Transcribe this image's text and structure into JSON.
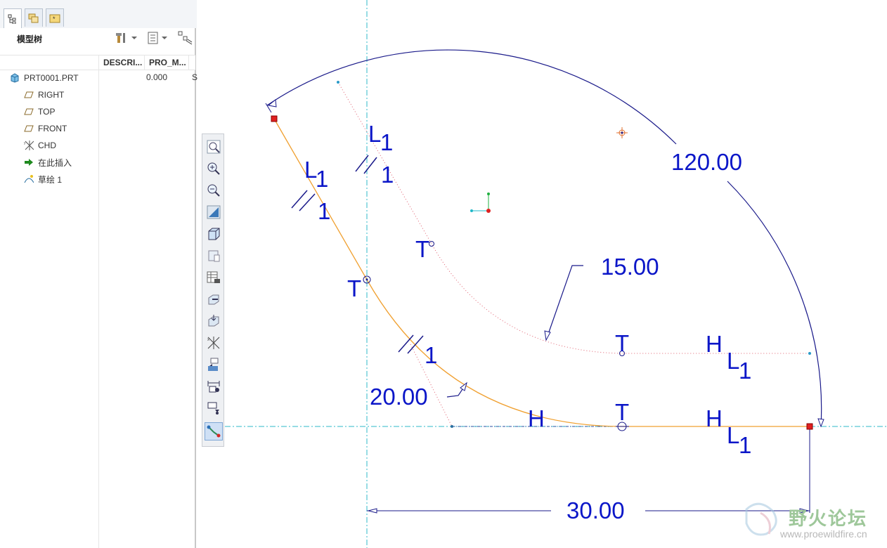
{
  "panel": {
    "title": "模型树",
    "columns": [
      "DESCRI...",
      "PRO_M..."
    ],
    "col_extra": "S",
    "tabs": [
      "model-tree-tab",
      "layers-tab",
      "favorites-tab"
    ]
  },
  "tree": {
    "items": [
      {
        "label": "PRT0001.PRT",
        "value": "0.000",
        "icon": "part-icon"
      },
      {
        "label": "RIGHT",
        "icon": "datum-plane-icon"
      },
      {
        "label": "TOP",
        "icon": "datum-plane-icon"
      },
      {
        "label": "FRONT",
        "icon": "datum-plane-icon"
      },
      {
        "label": "CHD",
        "icon": "coordinate-system-icon"
      },
      {
        "label": "在此插入",
        "icon": "insert-arrow-icon"
      },
      {
        "label": "草绘 1",
        "icon": "sketch-icon"
      }
    ]
  },
  "toolbar": {
    "buttons": [
      "zoom-fit-icon",
      "zoom-in-icon",
      "zoom-out-icon",
      "repaint-icon",
      "view-orient-icon",
      "saved-views-icon",
      "layer-cam-icon",
      "plane-display-icon",
      "axis-display-icon",
      "csys-display-icon",
      "model-display-icon",
      "dimension-display-icon",
      "constraint-display-icon",
      "sketch-display-icon"
    ]
  },
  "sketch": {
    "dimensions": {
      "angle": "120.00",
      "radius_small": "15.00",
      "radius_large": "20.00",
      "horizontal": "30.00"
    },
    "constraints": {
      "T": "T",
      "H": "H",
      "L": "L",
      "sub1": "1",
      "equal_mark": "1"
    }
  },
  "watermark": {
    "name": "野火论坛",
    "url": "www.proewildfire.cn"
  },
  "colors": {
    "dimension": "#0b16c8",
    "sketch_line": "#f0a030",
    "centerline": "#2fb8c8",
    "construction": "#e06070",
    "point_red": "#e02020"
  }
}
